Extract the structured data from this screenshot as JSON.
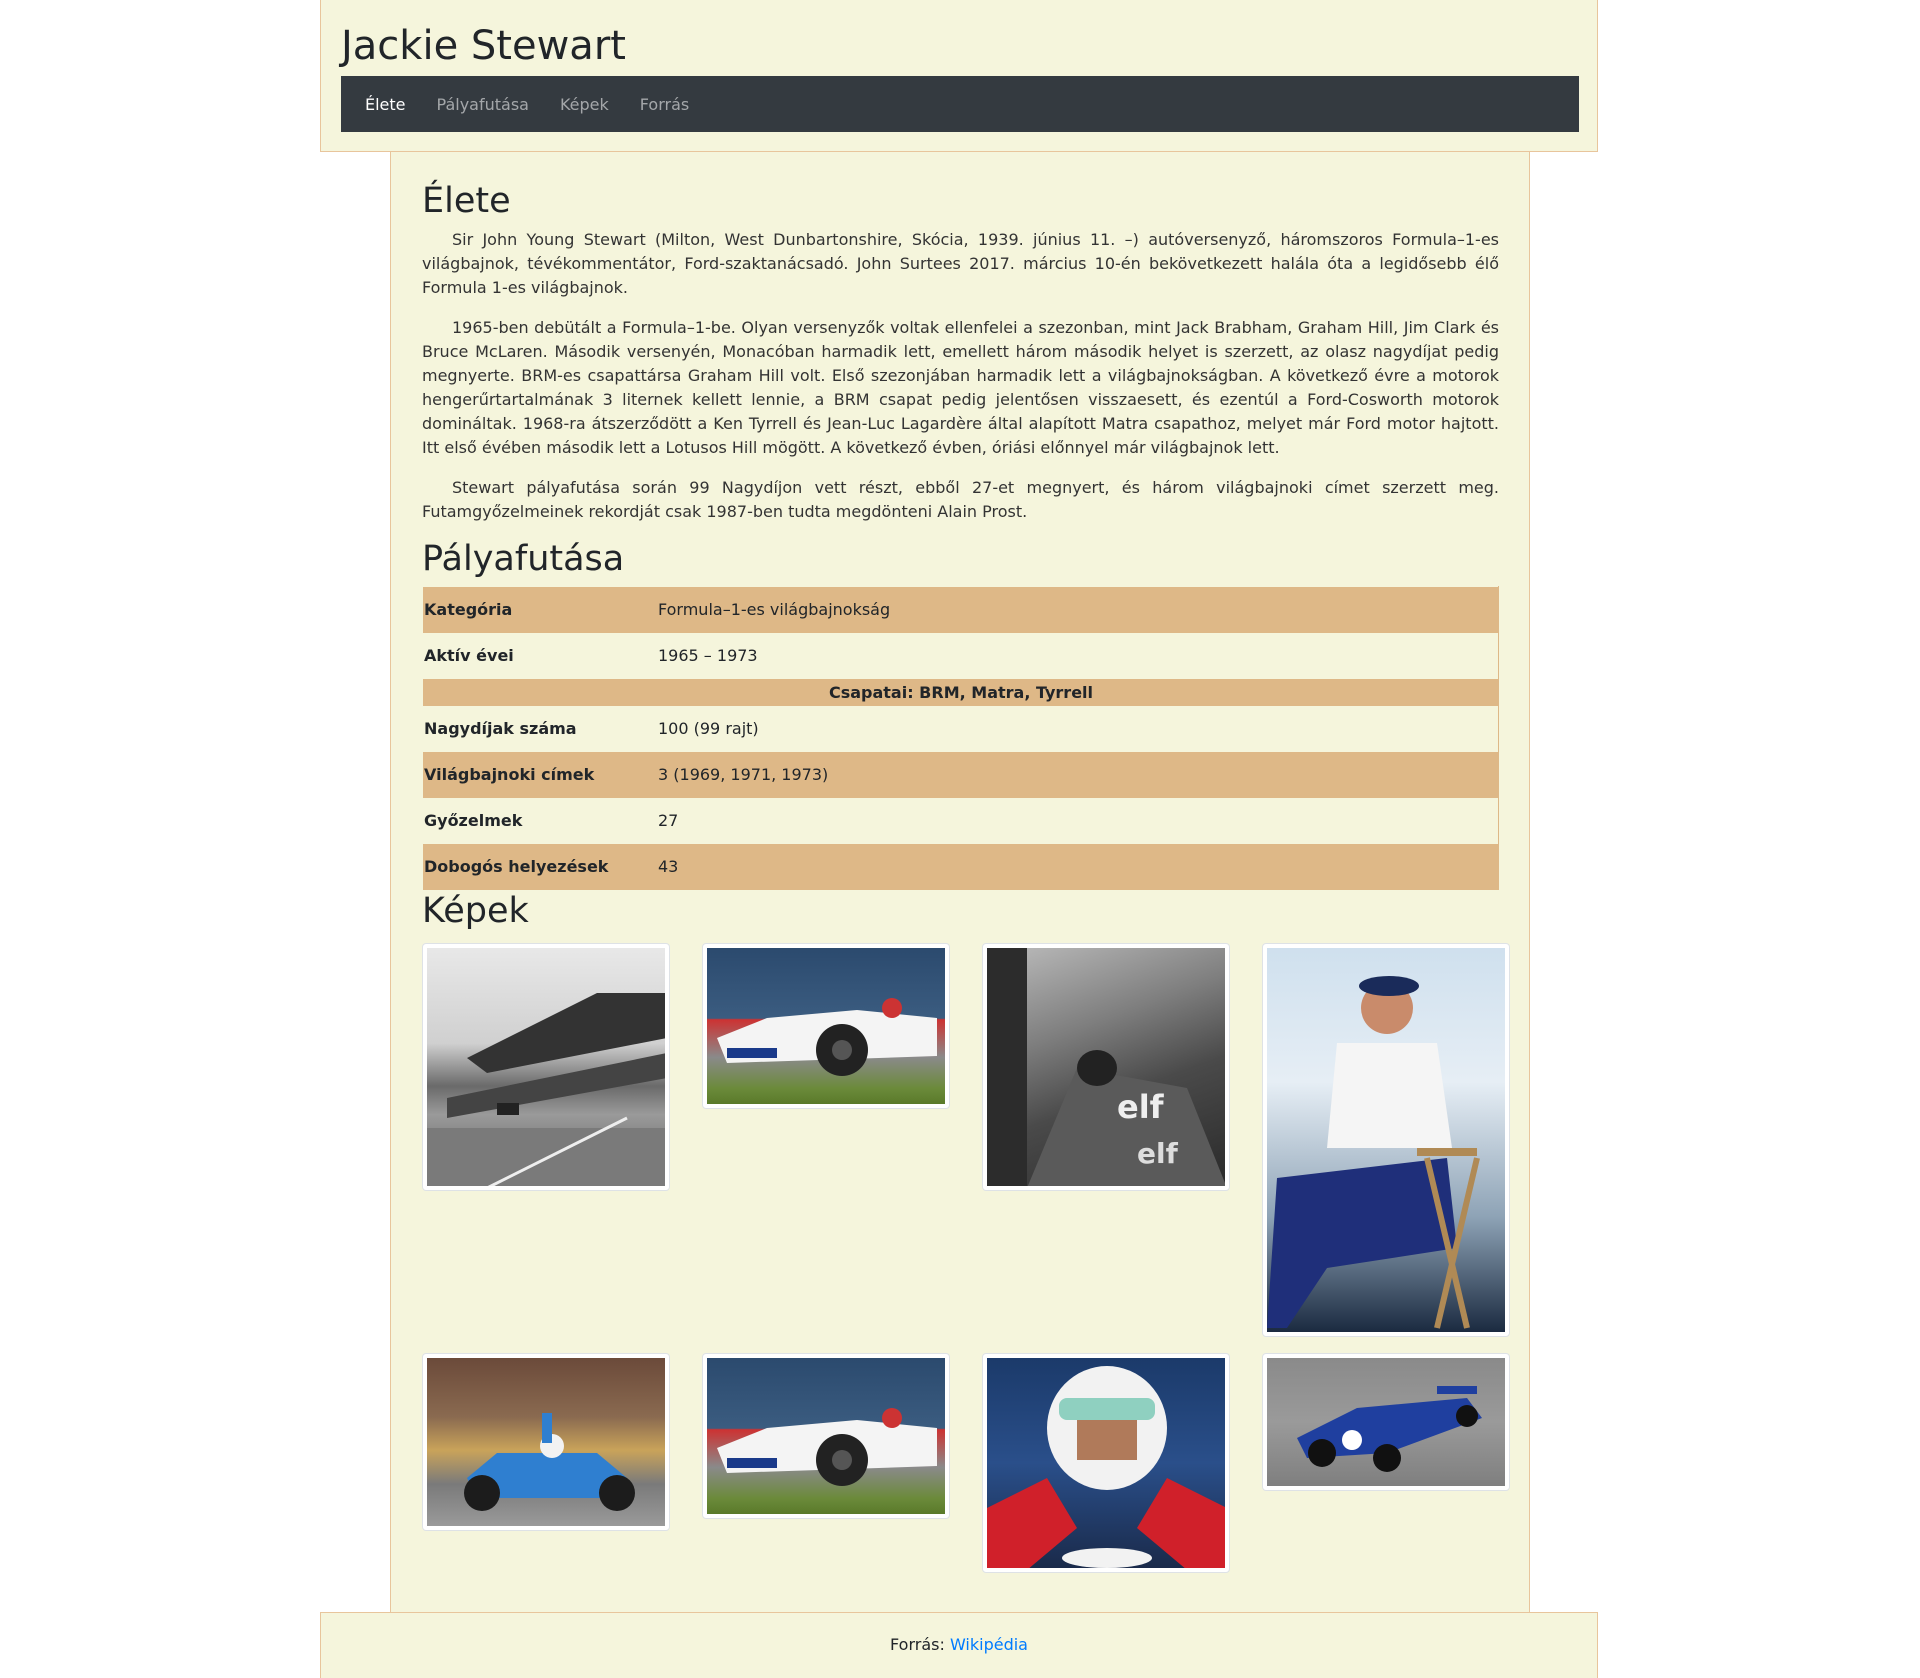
{
  "header": {
    "title": "Jackie Stewart"
  },
  "nav": [
    {
      "label": "Élete",
      "active": true
    },
    {
      "label": "Pályafutása",
      "active": false
    },
    {
      "label": "Képek",
      "active": false
    },
    {
      "label": "Forrás",
      "active": false
    }
  ],
  "elete": {
    "heading": "Élete",
    "paragraphs": [
      "Sir John Young Stewart (Milton, West Dunbartonshire, Skócia, 1939. június 11. –) autóversenyző, háromszoros Formula–1-es világbajnok, tévékommentátor, Ford-szaktanácsadó. John Surtees 2017. március 10-én bekövetkezett halála óta a legidősebb élő Formula 1-es világbajnok.",
      "1965-ben debütált a Formula–1-be. Olyan versenyzők voltak ellenfelei a szezonban, mint Jack Brabham, Graham Hill, Jim Clark és Bruce McLaren. Második versenyén, Monacóban harmadik lett, emellett három második helyet is szerzett, az olasz nagydíjat pedig megnyerte. BRM-es csapattársa Graham Hill volt. Első szezonjában harmadik lett a világbajnokságban. A következő évre a motorok hengerűrtartalmának 3 liternek kellett lennie, a BRM csapat pedig jelentősen visszaesett, és ezentúl a Ford-Cosworth motorok domináltak. 1968-ra átszerződött a Ken Tyrrell és Jean-Luc Lagardère által alapított Matra csapathoz, melyet már Ford motor hajtott. Itt első évében második lett a Lotusos Hill mögött. A következő évben, óriási előnnyel már világbajnok lett.",
      "Stewart pályafutása során 99 Nagydíjon vett részt, ebből 27-et megnyert, és három világbajnoki címet szerzett meg. Futamgyőzelmeinek rekordját csak 1987-ben tudta megdönteni Alain Prost."
    ]
  },
  "palyafutasa": {
    "heading": "Pályafutása",
    "rows": [
      {
        "label": "Kategória",
        "value": "Formula–1-es világbajnokság"
      },
      {
        "label": "Aktív évei",
        "value": "1965 – 1973"
      }
    ],
    "teams": "Csapatai: BRM, Matra, Tyrrell",
    "rows2": [
      {
        "label": "Nagydíjak száma",
        "value": "100 (99 rajt)"
      },
      {
        "label": "Világbajnoki címek",
        "value": "3 (1969, 1971, 1973)"
      },
      {
        "label": "Győzelmek",
        "value": "27"
      },
      {
        "label": "Dobogós helyezések",
        "value": "43"
      }
    ]
  },
  "kepek": {
    "heading": "Képek",
    "images": [
      {
        "name": "photo-rainy-grandstand"
      },
      {
        "name": "photo-white-f1-car"
      },
      {
        "name": "photo-driver-in-cockpit-bw"
      },
      {
        "name": "photo-stewart-with-microphone"
      },
      {
        "name": "photo-blue-matra-crowd"
      },
      {
        "name": "photo-white-f1-car-2"
      },
      {
        "name": "photo-driver-helmet-closeup"
      },
      {
        "name": "photo-blue-tyrrell-on-track"
      }
    ]
  },
  "footer": {
    "prefix": "Forrás:",
    "link_text": "Wikipédia"
  }
}
